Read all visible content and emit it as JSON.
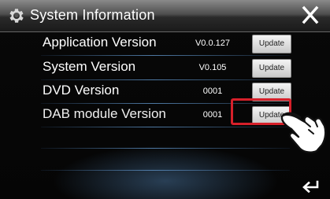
{
  "header": {
    "title": "System Information",
    "settings_icon": "gear-icon",
    "close_icon": "close-icon"
  },
  "versions": [
    {
      "label": "Application Version",
      "value": "V0.0.127",
      "button": "Update"
    },
    {
      "label": "System Version",
      "value": "V0.105",
      "button": "Update"
    },
    {
      "label": "DVD Version",
      "value": "0001",
      "button": "Update"
    },
    {
      "label": "DAB module Version",
      "value": "0001",
      "button": "Update"
    }
  ],
  "footer": {
    "back_icon": "back-arrow-icon"
  },
  "annotation": {
    "highlight_color": "#d6202a",
    "pointer_icon": "pointing-hand-icon"
  },
  "colors": {
    "divider": "#5a8cbe",
    "button_face": "#e6e6e6"
  }
}
